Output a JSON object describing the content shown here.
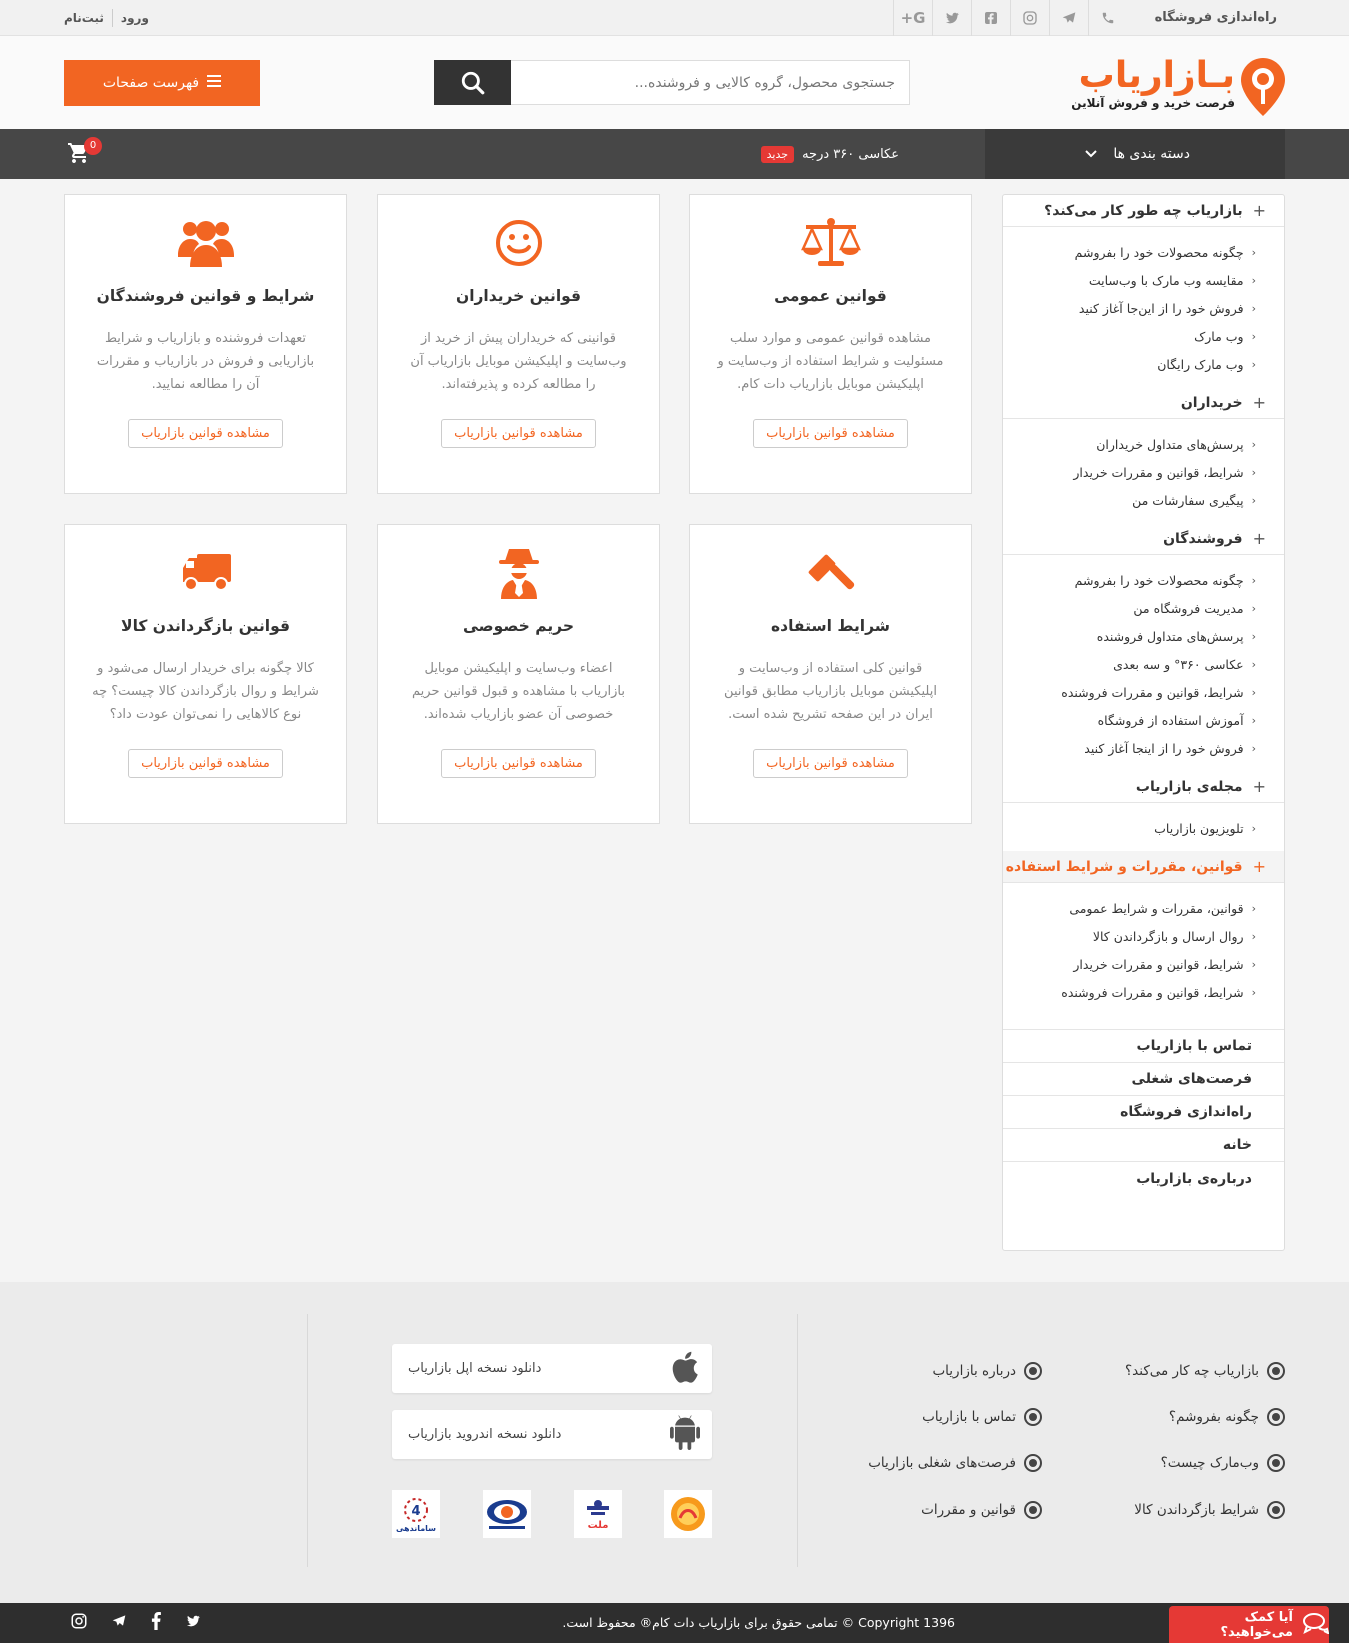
{
  "topbar": {
    "launch_store": "راه‌اندازی فروشگاه",
    "social_icons": [
      "phone-icon",
      "telegram-icon",
      "instagram-icon",
      "facebook-icon",
      "twitter-icon",
      "google-plus-icon"
    ],
    "login": "ورود",
    "register": "ثبت‌نام"
  },
  "header": {
    "logo_text_orange": "بـازار",
    "logo_text_dark": "یاب",
    "logo_tagline": "فرصت خرید و فروش آنلاین",
    "search_placeholder": "جستجوی محصول، گروه کالایی و فروشنده...",
    "pages_menu": "فهرست صفحات"
  },
  "nav": {
    "categories": "دسته بندی ها",
    "photo360": "عکاسی ۳۶۰ درجه",
    "new_badge": "جدید",
    "cart_count": "0"
  },
  "sidebar": {
    "sections": [
      {
        "title": "بازاریاب چه طور کار می‌کند؟",
        "items": [
          "چگونه محصولات خود را بفروشم",
          "مقایسه وب مارک با وب‌سایت",
          "فروش خود را از این‌جا آغاز کنید",
          "وب مارک",
          "وب مارک رایگان"
        ]
      },
      {
        "title": "خریداران",
        "items": [
          "پرسش‌های متداول خریداران",
          "شرایط، قوانین و مقررات خریدار",
          "پیگیری سفارشات من"
        ]
      },
      {
        "title": "فروشندگان",
        "items": [
          "چگونه محصولات خود را بفروشم",
          "مدیریت فروشگاه من",
          "پرسش‌های متداول فروشنده",
          "عکاسی ۳۶۰° و سه بعدی",
          "شرایط، قوانین و مقررات فروشنده",
          "آموزش استفاده از فروشگاه",
          "فروش خود را از اینجا آغاز کنید"
        ]
      },
      {
        "title": "مجله‌ی بازاریاب",
        "items": [
          "تلویزیون بازاریاب"
        ]
      },
      {
        "title": "قوانین، مقررات و شرایط استفاده",
        "items": [
          "قوانین، مقررات و شرایط عمومی",
          "روال ارسال و بازگرداندن کالا",
          "شرایط، قوانین و مقررات خریدار",
          "شرایط، قوانین و مقررات فروشنده"
        ]
      }
    ],
    "links": [
      "تماس با بازاریاب",
      "فرصت‌های شغلی",
      "راه‌اندازی فروشگاه",
      "خانه",
      "درباره‌ی بازاریاب"
    ]
  },
  "cards": [
    {
      "icon": "scale-icon",
      "title": "قوانین عمومی",
      "desc": "مشاهده قوانین عمومی و موارد سلب مسئولیت و شرایط استفاده از وب‌سایت و اپلیکیشن موبایل بازاریاب دات کام.",
      "button": "مشاهده قوانین بازاریاب"
    },
    {
      "icon": "smile-icon",
      "title": "قوانین خریداران",
      "desc": "قوانینی که خریداران پیش از خرید از وب‌سایت و اپلیکیشن موبایل بازاریاب آن را مطالعه کرده و پذیرفته‌اند.",
      "button": "مشاهده قوانین بازاریاب"
    },
    {
      "icon": "users-icon",
      "title": "شرایط و قوانین فروشندگان",
      "desc": "تعهدات فروشنده و بازاریاب و شرایط بازاریابی و فروش در بازاریاب و مقررات آن را مطالعه نمایید.",
      "button": "مشاهده قوانین بازاریاب"
    },
    {
      "icon": "gavel-icon",
      "title": "شرایط استفاده",
      "desc": "قوانین کلی استفاده از وب‌سایت و اپلیکیشن موبایل بازاریاب مطابق قوانین ایران در این صفحه تشریح شده است.",
      "button": "مشاهده قوانین بازاریاب"
    },
    {
      "icon": "spy-icon",
      "title": "حریم خصوصی",
      "desc": "اعضاء وب‌سایت و اپلیکیشن موبایل بازاریاب با مشاهده و قبول قوانین حریم خصوصی آن عضو بازاریاب شده‌اند.",
      "button": "مشاهده قوانین بازاریاب"
    },
    {
      "icon": "truck-icon",
      "title": "قوانین بازگرداندن کالا",
      "desc": "کالا چگونه برای خریدار ارسال می‌شود و شرایط و روال بازگرداندن کالا چیست؟ چه نوع کالاهایی را نمی‌توان عودت داد؟",
      "button": "مشاهده قوانین بازاریاب"
    }
  ],
  "footer": {
    "links_col1": [
      "بازاریاب چه کار می‌کند؟",
      "چگونه بفروشم؟",
      "وب‌مارک چیست؟",
      "شرایط بازگرداندن کالا"
    ],
    "links_col2": [
      "درباره بازاریاب",
      "تماس با بازاریاب",
      "فرصت‌های شغلی بازاریاب",
      "قوانین و مقررات"
    ],
    "apple_download": "دانلود نسخه اپل بازاریاب",
    "android_download": "دانلود نسخه اندروید بازاریاب",
    "badge_mellat": "ملت",
    "badge_samandehi": "ساماندهی",
    "copyright": "Copyright 1396 © تمامی حقوق برای بازاریاب دات کام® محفوظ است.",
    "help": "آیا کمک می‌خواهید؟",
    "bottom_social_icons": [
      "instagram-icon",
      "telegram-icon",
      "facebook-icon",
      "twitter-icon"
    ]
  },
  "colors": {
    "accent": "#f26522",
    "dark_nav": "#474747",
    "badge_red": "#e53935"
  }
}
